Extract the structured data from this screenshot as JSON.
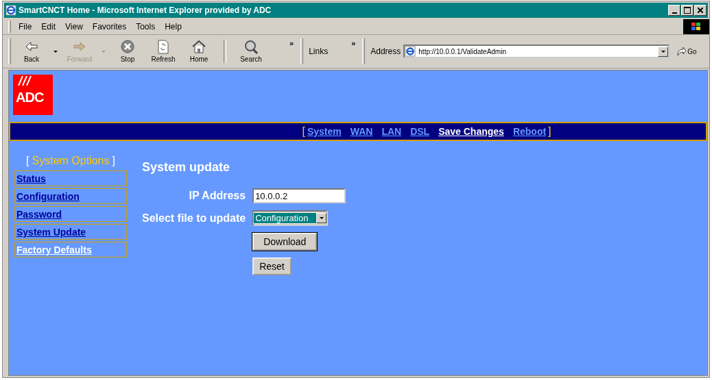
{
  "window": {
    "title": "SmartCNCT Home - Microsoft Internet Explorer provided by ADC"
  },
  "menu": [
    "File",
    "Edit",
    "View",
    "Favorites",
    "Tools",
    "Help"
  ],
  "toolbar": [
    {
      "label": "Back",
      "kind": "back",
      "disabled": false,
      "dropdown": true
    },
    {
      "label": "Forward",
      "kind": "forward",
      "disabled": true,
      "dropdown": true
    },
    {
      "label": "Stop",
      "kind": "stop",
      "disabled": false,
      "dropdown": false
    },
    {
      "label": "Refresh",
      "kind": "refresh",
      "disabled": false,
      "dropdown": false
    },
    {
      "label": "Home",
      "kind": "home",
      "disabled": false,
      "dropdown": false
    },
    {
      "label": "Search",
      "kind": "search",
      "disabled": false,
      "dropdown": false
    }
  ],
  "chevrons": [
    "»",
    "»"
  ],
  "links_label": "Links",
  "address": {
    "label": "Address",
    "value": "http://10.0.0.1/ValidateAdmin",
    "go": "Go"
  },
  "logo": {
    "text": "ADC"
  },
  "nav": {
    "open": "[",
    "close": "]",
    "items": [
      {
        "label": "System",
        "highlighted": false
      },
      {
        "label": "WAN",
        "highlighted": false
      },
      {
        "label": "LAN",
        "highlighted": false
      },
      {
        "label": "DSL",
        "highlighted": false
      },
      {
        "label": "Save Changes",
        "highlighted": true
      },
      {
        "label": "Reboot",
        "highlighted": false
      }
    ]
  },
  "sidebar": {
    "open": "[",
    "title": "System Options",
    "close": "]",
    "items": [
      {
        "label": "Status",
        "highlighted": false
      },
      {
        "label": "Configuration",
        "highlighted": false
      },
      {
        "label": "Password",
        "highlighted": false
      },
      {
        "label": "System Update",
        "highlighted": false
      },
      {
        "label": "Factory Defaults",
        "highlighted": true
      }
    ]
  },
  "form": {
    "heading": "System update",
    "ip_label": "IP Address",
    "ip_value": "10.0.0.2",
    "file_label": "Select file to update",
    "file_value": "Configuration",
    "buttons": [
      {
        "label": "Download",
        "default": true
      },
      {
        "label": "Reset",
        "default": false
      }
    ]
  }
}
